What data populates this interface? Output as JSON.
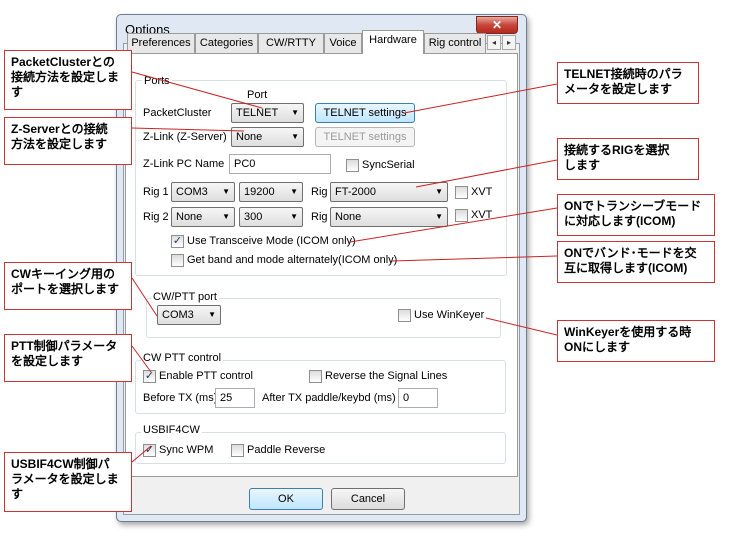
{
  "dialog": {
    "title": "Options",
    "close_glyph": "✕",
    "tabs": [
      "Preferences",
      "Categories",
      "CW/RTTY",
      "Voice",
      "Hardware",
      "Rig control"
    ],
    "active_tab": "Hardware",
    "tab_scroll_left": "◂",
    "tab_scroll_right": "▸"
  },
  "ports": {
    "group_label": "Ports",
    "port_header": "Port",
    "packetcluster_label": "PacketCluster",
    "packetcluster_port": "TELNET",
    "telnet_settings": "TELNET settings",
    "zlink_label": "Z-Link (Z-Server)",
    "zlink_port": "None",
    "zlink_telnet_settings": "TELNET settings",
    "zlink_pc_name_label": "Z-Link PC Name",
    "zlink_pc_name_value": "PC0",
    "syncserial_label": "SyncSerial",
    "rig1_label": "Rig 1",
    "rig1_port": "COM3",
    "rig1_speed": "19200",
    "rig1_rig_label": "Rig",
    "rig1_model": "FT-2000",
    "rig1_xvt": "XVT",
    "rig2_label": "Rig 2",
    "rig2_port": "None",
    "rig2_speed": "300",
    "rig2_rig_label": "Rig",
    "rig2_model": "None",
    "rig2_xvt": "XVT",
    "use_transceive": "Use Transceive Mode (ICOM only)",
    "get_band_mode": "Get band and mode alternately(ICOM only)"
  },
  "cwptt_port": {
    "group_label": "CW/PTT port",
    "port": "COM3",
    "use_winkeyer": "Use WinKeyer"
  },
  "cw_ptt_control": {
    "group_label": "CW PTT control",
    "enable_ptt": "Enable PTT control",
    "reverse_signal": "Reverse the Signal Lines",
    "before_tx_label": "Before TX (ms)",
    "before_tx_value": "25",
    "after_tx_label": "After TX paddle/keybd (ms)",
    "after_tx_value": "0"
  },
  "usbif4cw": {
    "group_label": "USBIF4CW",
    "sync_wpm": "Sync WPM",
    "paddle_reverse": "Paddle Reverse"
  },
  "footer": {
    "ok": "OK",
    "cancel": "Cancel"
  },
  "glyphs": {
    "check": "✓",
    "dropdown": "▼"
  },
  "callouts": {
    "packetcluster": [
      "PacketClusterとの",
      "接続方法を設定しま",
      "す"
    ],
    "zserver": [
      "Z-Serverとの接続",
      "方法を設定します"
    ],
    "cw_keying": [
      "CWキーイング用の",
      "ポートを選択します"
    ],
    "ptt": [
      "PTT制御パラメータ",
      "を設定します"
    ],
    "usbif4cw": [
      "USBIF4CW制御パ",
      "ラメータを設定しま",
      "す"
    ],
    "telnet": [
      "TELNET接続時のパラ",
      "メータを設定します"
    ],
    "rig": [
      "接続するRIGを選択",
      "します"
    ],
    "transceive": [
      "ONでトランシーブモード",
      "に対応します(ICOM)"
    ],
    "band_mode": [
      "ONでバンド･モードを交",
      "互に取得します(ICOM)"
    ],
    "winkeyer": [
      "WinKeyerを使用する時",
      "ONにします"
    ]
  },
  "colors": {
    "callout_border": "#cc3333",
    "leader_line": "#cc2222"
  }
}
